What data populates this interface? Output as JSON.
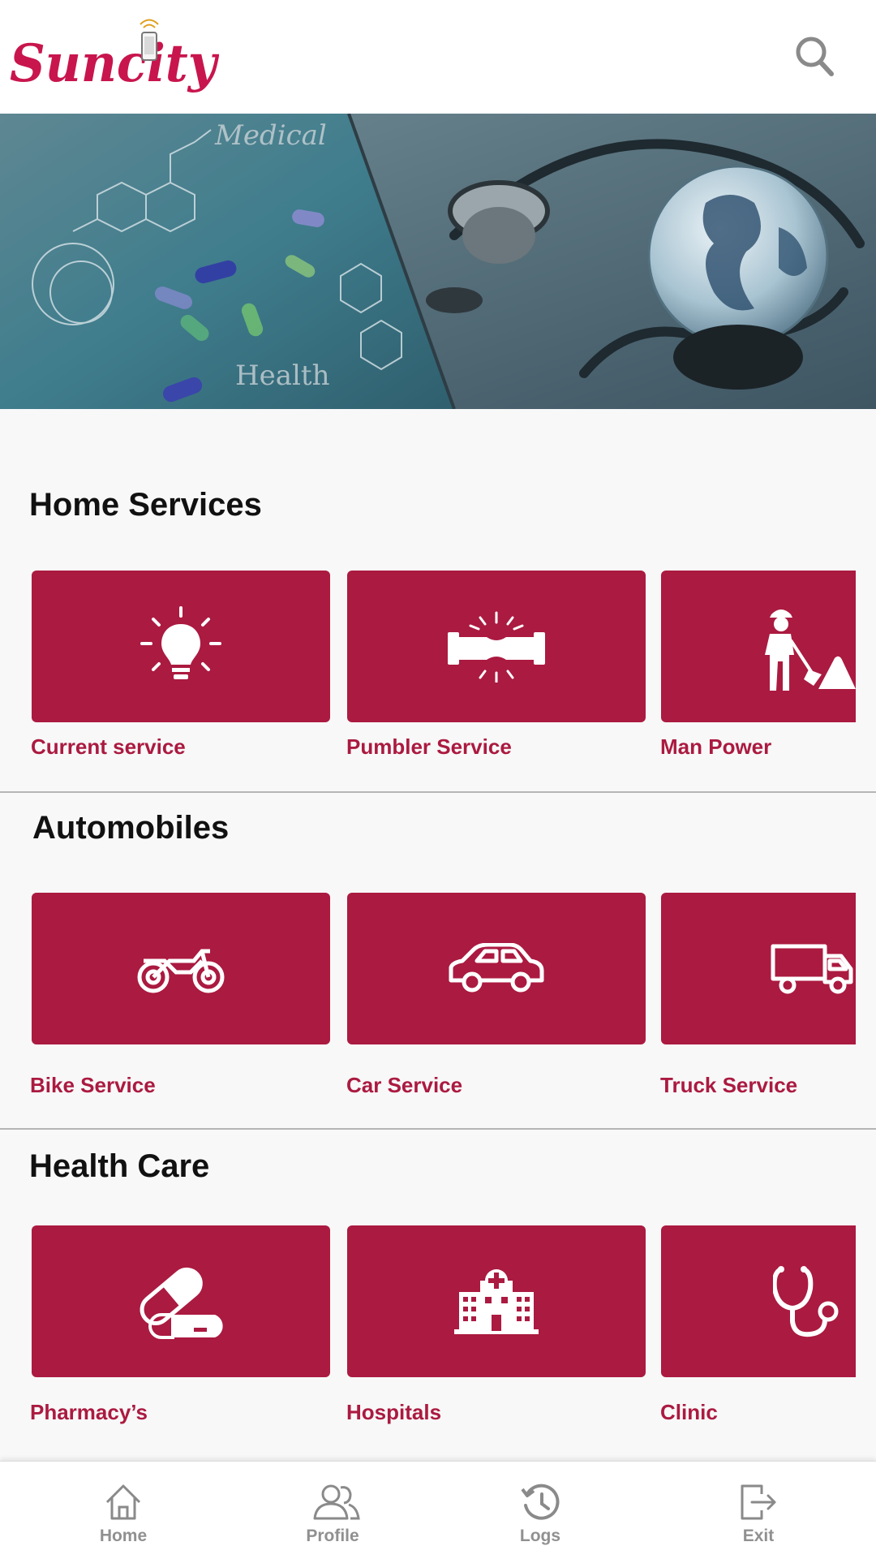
{
  "header": {
    "logo_text": "Suncity",
    "logo_icon": "phone-signal-icon",
    "search_icon": "search-icon"
  },
  "banner": {
    "word_top": "Medical",
    "word_bottom": "Health",
    "slides_total": 4,
    "active_slide": 1
  },
  "sections": [
    {
      "title": "Home Services",
      "items": [
        {
          "label": "Current service",
          "icon": "lightbulb-icon"
        },
        {
          "label": "Pumbler Service",
          "icon": "pipe-icon"
        },
        {
          "label": "Man Power",
          "icon": "worker-shovel-icon"
        }
      ]
    },
    {
      "title": "Automobiles",
      "items": [
        {
          "label": "Bike Service",
          "icon": "motorcycle-icon"
        },
        {
          "label": "Car Service",
          "icon": "car-icon"
        },
        {
          "label": "Truck Service",
          "icon": "truck-icon"
        }
      ]
    },
    {
      "title": "Health Care",
      "items": [
        {
          "label": "Pharmacy’s",
          "icon": "pill-icon"
        },
        {
          "label": "Hospitals",
          "icon": "hospital-icon"
        },
        {
          "label": "Clinic",
          "icon": "stethoscope-icon"
        }
      ]
    }
  ],
  "bottom_nav": [
    {
      "label": "Home",
      "icon": "home-icon"
    },
    {
      "label": "Profile",
      "icon": "profile-icon"
    },
    {
      "label": "Logs",
      "icon": "history-icon"
    },
    {
      "label": "Exit",
      "icon": "exit-icon"
    }
  ],
  "colors": {
    "brand": "#c8154d",
    "card": "#ab1a40",
    "nav_text": "#909090"
  }
}
